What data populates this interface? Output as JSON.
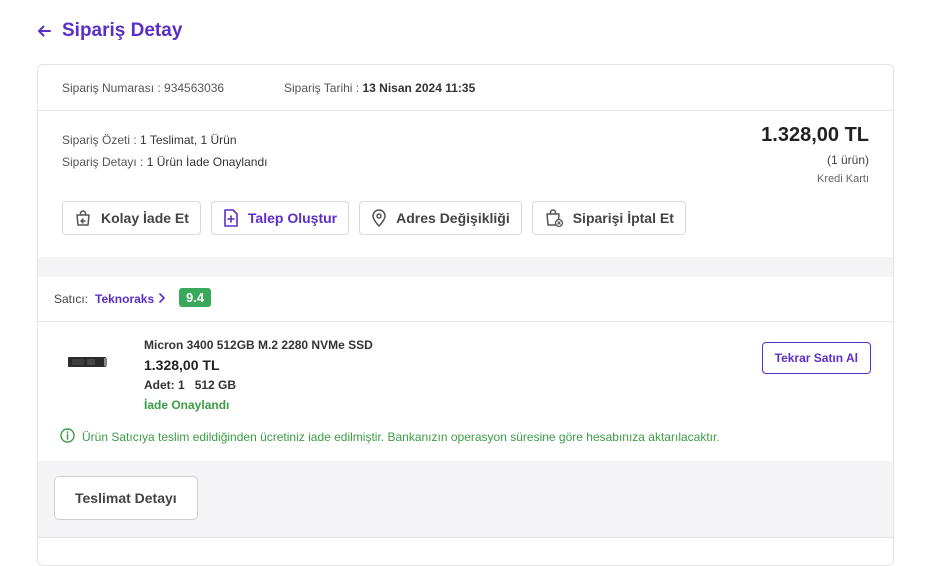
{
  "header": {
    "title": "Sipariş Detay"
  },
  "meta": {
    "order_no_label": "Sipariş Numarası : ",
    "order_no": "934563036",
    "order_date_label": "Sipariş Tarihi : ",
    "order_date": "13 Nisan 2024 11:35"
  },
  "summary": {
    "label": "Sipariş Özeti : ",
    "value": "1 Teslimat, 1 Ürün",
    "detail_label": "Sipariş Detayı : ",
    "detail_value": "1 Ürün İade Onaylandı"
  },
  "price": {
    "total": "1.328,00 TL",
    "count": "(1 ürün)",
    "payment": "Kredi Kartı"
  },
  "actions": {
    "easy_return": "Kolay İade Et",
    "create_request": "Talep Oluştur",
    "address_change": "Adres Değişikliği",
    "cancel_order": "Siparişi İptal Et"
  },
  "seller": {
    "label": "Satıcı:",
    "name": "Teknoraks",
    "score": "9.4"
  },
  "product": {
    "name": "Micron 3400 512GB M.2 2280 NVMe SSD",
    "price": "1.328,00 TL",
    "qty_label": "Adet: ",
    "qty": "1",
    "variant": "512 GB",
    "status": "İade Onaylandı",
    "rebuy": "Tekrar Satın Al"
  },
  "notice": "Ürün Satıcıya teslim edildiğinden ücretiniz iade edilmiştir. Bankanızın operasyon süresine göre hesabınıza aktarılacaktır.",
  "delivery": {
    "button": "Teslimat Detayı"
  },
  "colors": {
    "accent": "#5b2ec7",
    "success": "#3a9c45",
    "score_bg": "#3aa85a"
  }
}
